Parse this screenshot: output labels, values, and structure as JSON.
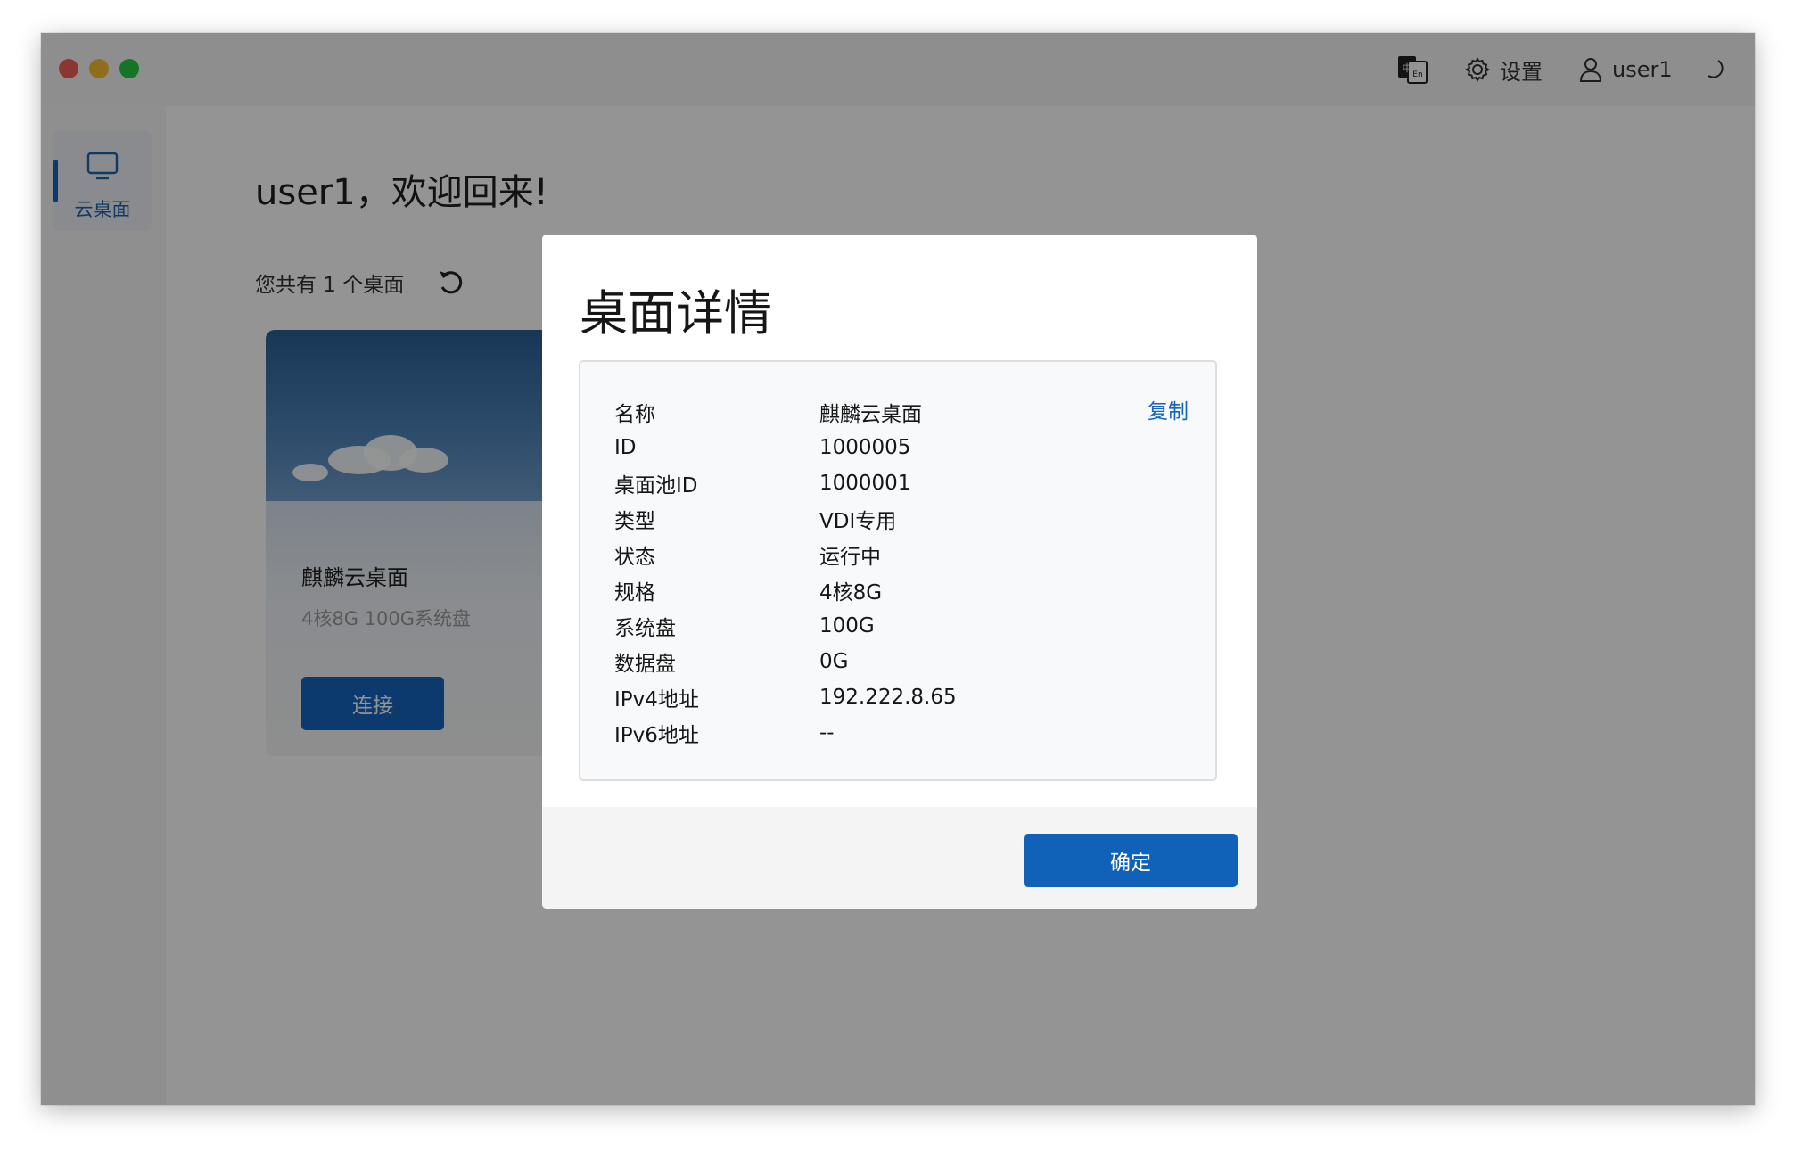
{
  "titlebar": {
    "language_icon": "language-switch-icon",
    "settings_label": "设置",
    "settings_icon": "gear-icon",
    "user_label": "user1",
    "user_icon": "user-icon",
    "theme_icon": "moon-icon"
  },
  "sidebar": {
    "items": [
      {
        "label": "云桌面",
        "icon": "monitor-icon",
        "active": true
      }
    ]
  },
  "main": {
    "welcome": "user1，欢迎回来!",
    "count_text": "您共有 1 个桌面",
    "refresh_icon": "refresh-icon",
    "desktops": [
      {
        "name": "麒麟云桌面",
        "spec": "4核8G 100G系统盘",
        "connect_label": "连接"
      }
    ]
  },
  "modal": {
    "title": "桌面详情",
    "copy_label": "复制",
    "details": [
      {
        "key": "名称",
        "value": "麒麟云桌面"
      },
      {
        "key": "ID",
        "value": "1000005"
      },
      {
        "key": "桌面池ID",
        "value": "1000001"
      },
      {
        "key": "类型",
        "value": "VDI专用"
      },
      {
        "key": "状态",
        "value": "运行中"
      },
      {
        "key": "规格",
        "value": "4核8G"
      },
      {
        "key": "系统盘",
        "value": "100G"
      },
      {
        "key": "数据盘",
        "value": "0G"
      },
      {
        "key": "IPv4地址",
        "value": "192.222.8.65"
      },
      {
        "key": "IPv6地址",
        "value": "--"
      }
    ],
    "ok_label": "确定"
  },
  "colors": {
    "accent": "#1565c0",
    "overlay": "rgba(0,0,0,0.42)"
  }
}
